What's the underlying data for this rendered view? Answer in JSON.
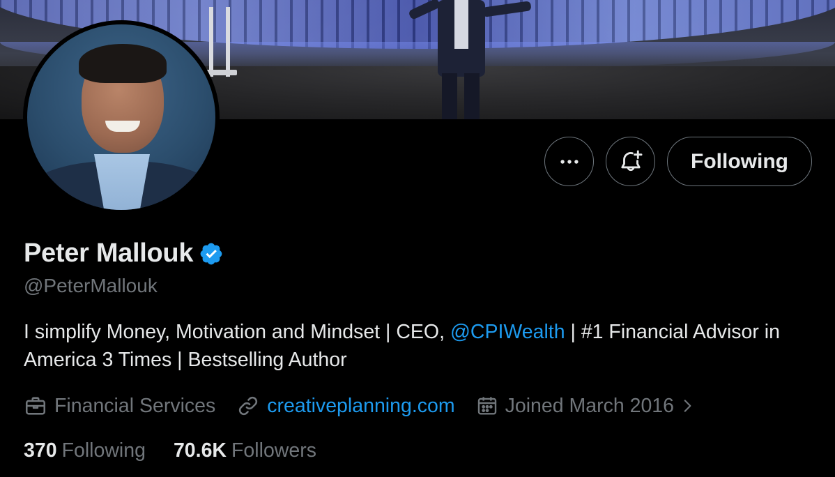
{
  "profile": {
    "name": "Peter Mallouk",
    "handle": "@PeterMallouk",
    "bio": {
      "part1": "I simplify Money, Motivation and Mindset | CEO, ",
      "mention": "@CPIWealth",
      "part2": " | #1 Financial Advisor in America 3 Times | Bestselling Author"
    },
    "category": "Financial Services",
    "website": "creativeplanning.com",
    "joined": "Joined March 2016",
    "following_count": "370",
    "following_label": "Following",
    "followers_count": "70.6K",
    "followers_label": "Followers"
  },
  "actions": {
    "more_icon": "more-horizontal-icon",
    "notify_icon": "bell-plus-icon",
    "follow_button_label": "Following"
  },
  "icons": {
    "verified": "verified-badge-icon",
    "category": "briefcase-icon",
    "website": "link-icon",
    "joined": "calendar-icon",
    "expand": "chevron-right-icon"
  },
  "colors": {
    "background": "#000000",
    "text_primary": "#e7e9ea",
    "text_secondary": "#71767b",
    "link": "#1d9bf0",
    "verified": "#1d9bf0",
    "border": "#6e767d"
  }
}
